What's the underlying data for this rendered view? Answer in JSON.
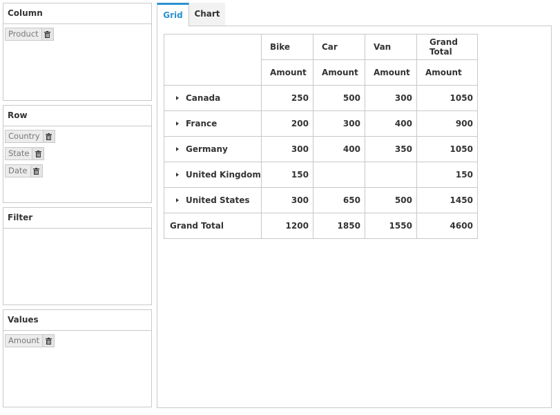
{
  "panels": {
    "column": {
      "title": "Column",
      "items": [
        {
          "label": "Product"
        }
      ]
    },
    "row": {
      "title": "Row",
      "items": [
        {
          "label": "Country"
        },
        {
          "label": "State"
        },
        {
          "label": "Date"
        }
      ]
    },
    "filter": {
      "title": "Filter",
      "items": []
    },
    "values": {
      "title": "Values",
      "items": [
        {
          "label": "Amount"
        }
      ]
    }
  },
  "tabs": [
    {
      "label": "Grid",
      "active": true
    },
    {
      "label": "Chart",
      "active": false
    }
  ],
  "grid": {
    "columns": [
      "Bike",
      "Car",
      "Van",
      "Grand Total"
    ],
    "measure": "Amount",
    "rows": [
      {
        "label": "Canada",
        "values": [
          "250",
          "500",
          "300",
          "1050"
        ]
      },
      {
        "label": "France",
        "values": [
          "200",
          "300",
          "400",
          "900"
        ]
      },
      {
        "label": "Germany",
        "values": [
          "300",
          "400",
          "350",
          "1050"
        ]
      },
      {
        "label": "United Kingdom",
        "values": [
          "150",
          "",
          "",
          "150"
        ]
      },
      {
        "label": "United States",
        "values": [
          "300",
          "650",
          "500",
          "1450"
        ]
      }
    ],
    "grand_total": {
      "label": "Grand Total",
      "values": [
        "1200",
        "1850",
        "1550",
        "4600"
      ]
    }
  },
  "colors": {
    "accent": "#2a91d0",
    "border": "#c8c8c8",
    "chip_bg": "#ececec"
  }
}
